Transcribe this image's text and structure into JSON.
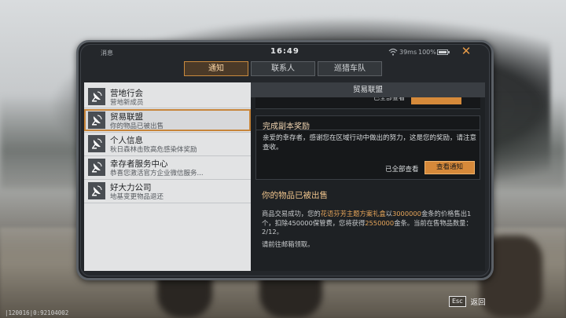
{
  "status": {
    "messages_label": "消息",
    "time": "16:49",
    "ping": "39ms",
    "battery_pct": "100%",
    "battery_level": 1.0
  },
  "tabs": [
    {
      "label": "通知",
      "active": true
    },
    {
      "label": "联系人",
      "active": false
    },
    {
      "label": "巡猎车队",
      "active": false
    }
  ],
  "list": [
    {
      "title": "营地行会",
      "subtitle": "营地新成员"
    },
    {
      "title": "贸易联盟",
      "subtitle": "你的物品已被出售"
    },
    {
      "title": "个人信息",
      "subtitle": "秋日森林击败高危感染体奖励"
    },
    {
      "title": "幸存者服务中心",
      "subtitle": "恭喜您激活官方企业微信服务..."
    },
    {
      "title": "好大力公司",
      "subtitle": "地基变更物品退还"
    }
  ],
  "detail": {
    "header": "贸易联盟",
    "card": {
      "title": "完成副本奖励",
      "body": "亲爱的幸存者，感谢您在区域行动中做出的努力，这是您的奖励，请注意查收。",
      "read_all": "已全部查看",
      "view_button": "查看通知"
    },
    "message": {
      "title": "你的物品已被出售",
      "body_prefix": "商品交易成功，您的",
      "item_name": "花语芬芳主题方案礼盒",
      "body_mid1": "以",
      "price": "3000000",
      "body_mid2": "金条的价格售出1个，扣除450000保管费，您将获得",
      "earned": "2550000",
      "body_suffix": "金条。当前在售物品数量：2/12。",
      "footer": "请前往邮箱领取。"
    }
  },
  "footer": {
    "id_text": "|120016|0:92104002",
    "esc_key": "Esc",
    "esc_label": "返回"
  },
  "colors": {
    "accent": "#d6893a",
    "highlight": "#e8a65a"
  }
}
